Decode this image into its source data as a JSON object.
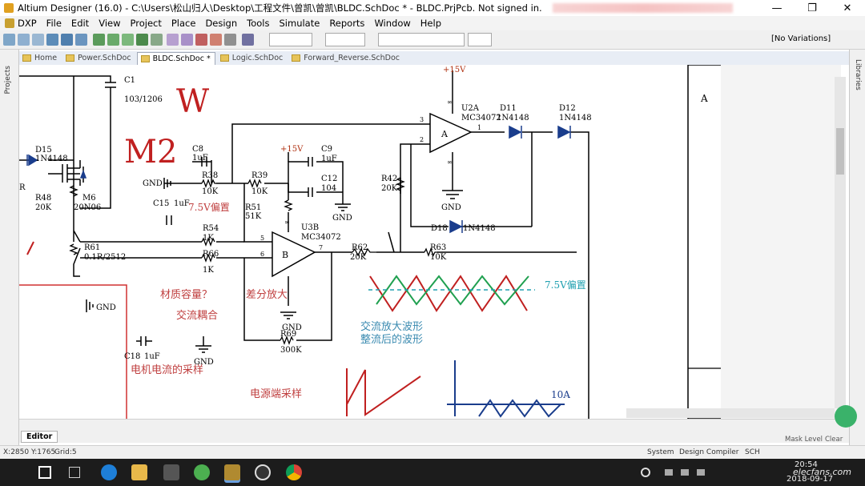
{
  "window": {
    "title": "Altium Designer (16.0) - C:\\Users\\松山归人\\Desktop\\工程文件\\曾凯\\曾凯\\BLDC.SchDoc * - BLDC.PrjPcb. Not signed in.",
    "controls": {
      "minimize": "—",
      "maximize": "❐",
      "close": "✕"
    }
  },
  "menu": [
    "DXP",
    "File",
    "Edit",
    "View",
    "Project",
    "Place",
    "Design",
    "Tools",
    "Simulate",
    "Reports",
    "Window",
    "Help"
  ],
  "toolbar": {
    "variations": "[No Variations]"
  },
  "tabs": [
    {
      "label": "Home"
    },
    {
      "label": "Power.SchDoc"
    },
    {
      "label": "BLDC.SchDoc *",
      "active": true
    },
    {
      "label": "Logic.SchDoc"
    },
    {
      "label": "Forward_Reverse.SchDoc"
    }
  ],
  "side": {
    "left": "Projects",
    "right": "Libraries"
  },
  "schematic": {
    "annotations": {
      "W": "W",
      "M2": "M2",
      "bias1": "7.5V偏置",
      "bias2": "7.5V偏置",
      "material": "材质容量？",
      "ac_coupling": "交流耦合",
      "diff_amp": "差分放大",
      "ac_wave": "交流放大波形",
      "rect_wave": "整流后的波形",
      "motor_sample": "电机电流的采样",
      "power_sample": "电源端采样",
      "ten_a": "10A",
      "zone_a": "A"
    },
    "parts": {
      "c1": "C1",
      "c1v": "103/1206",
      "d15": "D15",
      "d15v": "1N4148",
      "r48": "R48",
      "r48v": "20K",
      "m6": "M6",
      "m6v": "20N06",
      "xr": "R",
      "c8": "C8",
      "c8v": "1uF",
      "r38": "R38",
      "r38v": "10K",
      "r39": "R39",
      "r39v": "10K",
      "gnd": "GND",
      "c15": "C15",
      "c15v": "1uF",
      "r51": "R51",
      "r51v": "51K",
      "p15a": "+15V",
      "c9": "C9",
      "c9v": "1uF",
      "c12": "C12",
      "c12v": "104",
      "u3b": "U3B",
      "u3bv": "MC34072",
      "u3blab": "B",
      "r54": "R54",
      "r54v": "1K",
      "r66": "R66",
      "r66v": "1K",
      "r61": "R61",
      "r61v": "0.1R/2512",
      "r62": "R62",
      "r62v": "20K",
      "r63": "R63",
      "r63v": "10K",
      "r69": "R69",
      "r69v": "300K",
      "c18": "C18",
      "c18v": "1uF",
      "p15b": "+15V",
      "u2a": "U2A",
      "u2av": "MC34072",
      "u2alab": "A",
      "d11": "D11",
      "d11v": "1N4148",
      "d12": "D12",
      "d12v": "1N4148",
      "r42": "R42",
      "r42v": "20K",
      "d18": "D18",
      "d18v": "1N4148",
      "pin2": "2",
      "pin3": "3",
      "pin1": "1",
      "pin5": "5",
      "pin6": "6",
      "pin7": "7",
      "inf": "∞"
    }
  },
  "editor": {
    "label": "Editor",
    "mask_level": "Mask Level",
    "clear": "Clear"
  },
  "status": {
    "coords": "X:2850 Y:1765",
    "grid": "Grid:5",
    "system": "System",
    "design_compiler": "Design Compiler",
    "sch": "SCH"
  },
  "taskbar": {
    "clock": "20:54",
    "date": "2018-09-17",
    "watermark": "elecfans.com"
  }
}
